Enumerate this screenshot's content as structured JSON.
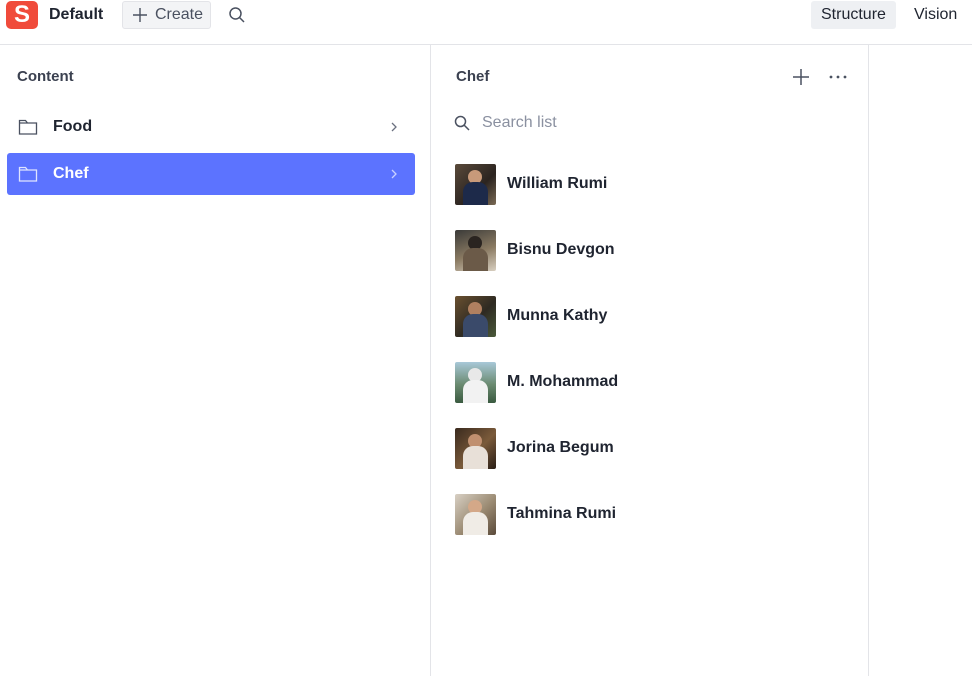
{
  "topbar": {
    "logo_letter": "S",
    "workspace": "Default",
    "create_label": "Create",
    "tools": [
      "Structure",
      "Vision"
    ]
  },
  "content_pane": {
    "title": "Content",
    "items": [
      {
        "label": "Food",
        "selected": false
      },
      {
        "label": "Chef",
        "selected": true
      }
    ]
  },
  "chef_pane": {
    "title": "Chef",
    "search_placeholder": "Search list",
    "chefs": [
      {
        "name": "William Rumi"
      },
      {
        "name": "Bisnu Devgon"
      },
      {
        "name": "Munna Kathy"
      },
      {
        "name": "M. Mohammad"
      },
      {
        "name": "Jorina Begum"
      },
      {
        "name": "Tahmina Rumi"
      }
    ]
  },
  "colors": {
    "brand": "#f04b3b",
    "selected": "#5c73ff",
    "border": "#e3e4e8"
  }
}
